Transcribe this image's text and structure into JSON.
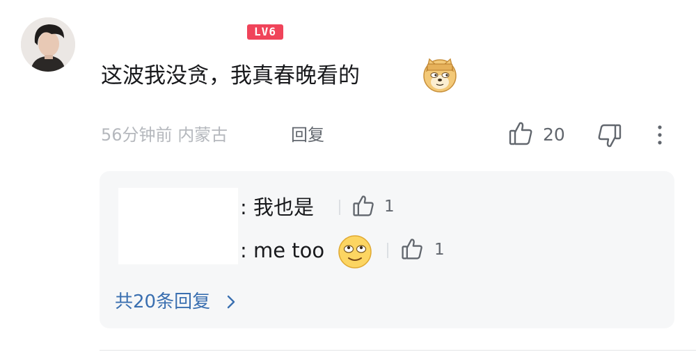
{
  "comment": {
    "level_badge": "LV6",
    "text": "这波我没贪，我真春晚看的",
    "emoji_icon": "doge-emoji",
    "time": "56分钟前",
    "location": "内蒙古",
    "reply_label": "回复",
    "like_count": "20"
  },
  "replies": [
    {
      "text": ": 我也是",
      "like_count": "1"
    },
    {
      "text": ": me too",
      "emoji_icon": "smile-emoji",
      "like_count": "1"
    }
  ],
  "view_all_replies": "共20条回复",
  "colors": {
    "accent_link": "#3a6fb0",
    "level_badge": "#f0445a",
    "reply_bg": "#f6f7f8"
  }
}
